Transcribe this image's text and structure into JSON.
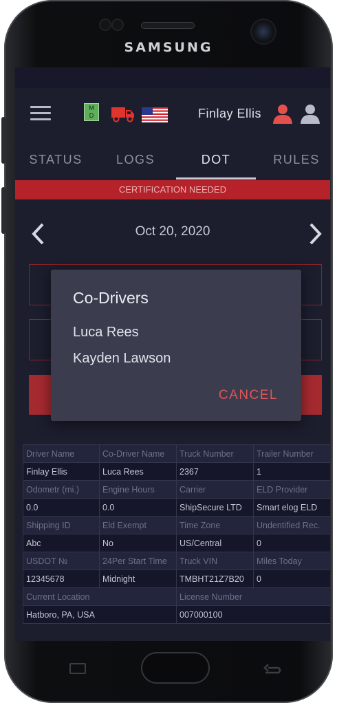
{
  "device": {
    "brand": "SAMSUNG"
  },
  "header": {
    "md_icon_text": [
      "M",
      "D"
    ],
    "driver_name": "Finlay Ellis",
    "icons": [
      "menu-icon",
      "md-icon",
      "truck-icon",
      "us-flag-icon",
      "person-icon",
      "person-icon"
    ],
    "colors": {
      "active_person": "#e5504c",
      "inactive_person": "#b9bcc8"
    }
  },
  "tabs": [
    {
      "label": "STATUS"
    },
    {
      "label": "LOGS"
    },
    {
      "label": "DOT",
      "active": true
    },
    {
      "label": "RULES"
    }
  ],
  "banner": {
    "text": "CERTIFICATION NEEDED",
    "color": "#b6222a"
  },
  "date_nav": {
    "date": "Oct 20, 2020"
  },
  "dialog": {
    "title": "Co-Drivers",
    "items": [
      "Luca Rees",
      "Kayden Lawson"
    ],
    "cancel_label": "CANCEL",
    "accent": "#e15559"
  },
  "info_table": {
    "rows": [
      {
        "labels": [
          "Driver Name",
          "Co-Driver Name",
          "Truck Number",
          "Trailer Number"
        ],
        "values": [
          "Finlay Ellis",
          "Luca Rees",
          "2367",
          "1"
        ]
      },
      {
        "labels": [
          "Odometr (mi.)",
          "Engine Hours",
          "Carrier",
          "ELD Provider"
        ],
        "values": [
          "0.0",
          "0.0",
          "ShipSecure LTD",
          "Smart elog ELD"
        ]
      },
      {
        "labels": [
          "Shipping ID",
          "Eld Exempt",
          "Time Zone",
          "Undentified Rec."
        ],
        "values": [
          "Abc",
          "No",
          "US/Central",
          "0"
        ]
      },
      {
        "labels": [
          "USDOT №",
          "24Per Start Time",
          "Truck VIN",
          "Miles Today"
        ],
        "values": [
          "12345678",
          "Midnight",
          "TMBHT21Z7B20",
          "0"
        ]
      }
    ],
    "last_row": {
      "labels": [
        "Current Location",
        "License Number"
      ],
      "values": [
        "Hatboro, PA, USA",
        "007000100"
      ]
    }
  }
}
